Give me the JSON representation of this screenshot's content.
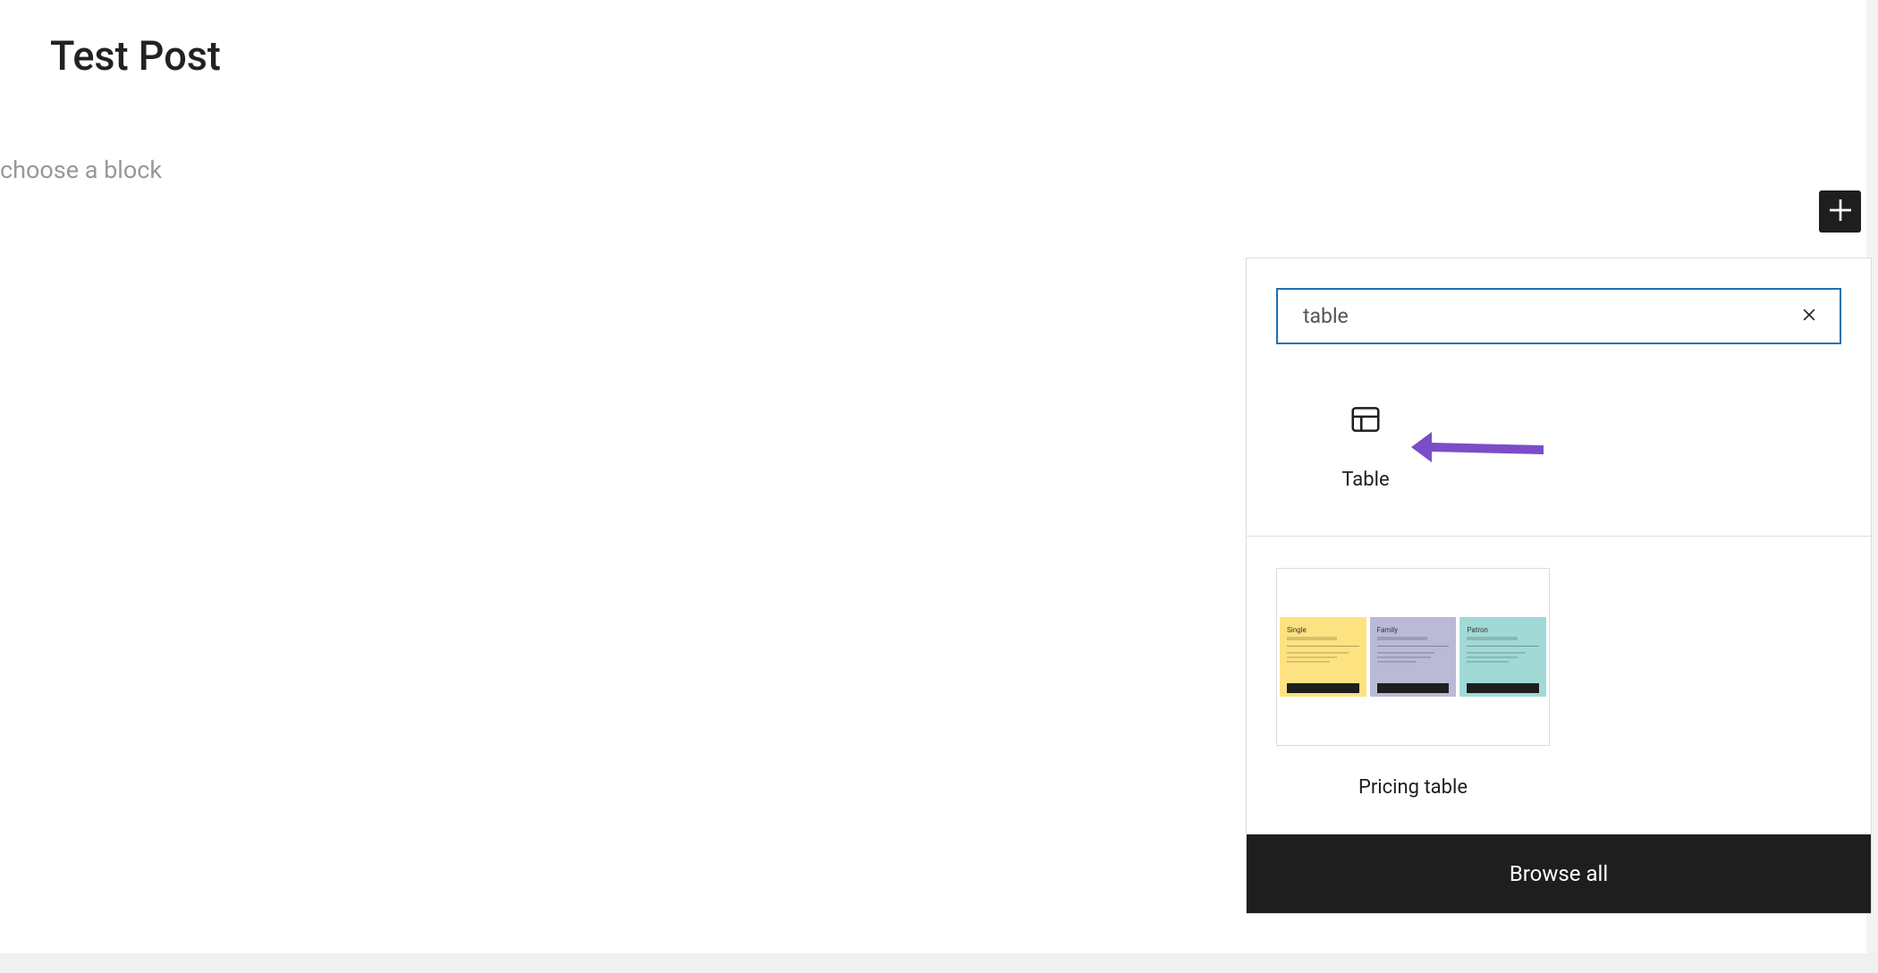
{
  "post": {
    "title": "Test Post",
    "placeholder": "choose a block"
  },
  "inserter": {
    "search": {
      "value": "table"
    },
    "blocks": [
      {
        "label": "Table",
        "icon": "table-icon"
      }
    ],
    "patterns": [
      {
        "label": "Pricing table",
        "cards": [
          {
            "title": "Single",
            "variant": "single"
          },
          {
            "title": "Family",
            "variant": "family"
          },
          {
            "title": "Patron",
            "variant": "patron"
          }
        ]
      }
    ],
    "browse_all_label": "Browse all"
  },
  "colors": {
    "accent": "#2271b1",
    "annotation": "#7b4dc8"
  }
}
